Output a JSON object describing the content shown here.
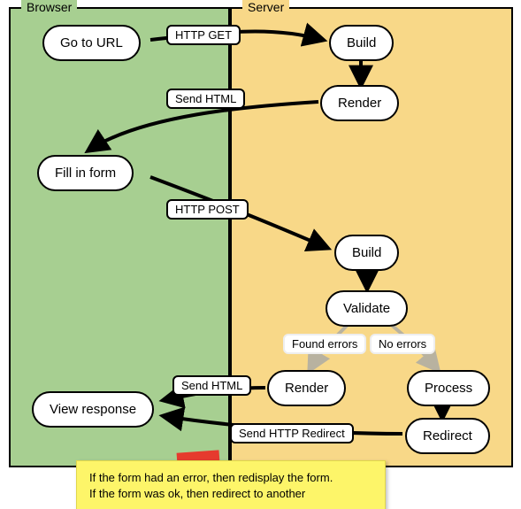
{
  "lanes": {
    "browser": "Browser",
    "server": "Server"
  },
  "steps": {
    "go_to_url": "Go to URL",
    "build1": "Build",
    "render1": "Render",
    "fill_form": "Fill in form",
    "build2": "Build",
    "validate": "Validate",
    "render2": "Render",
    "process": "Process",
    "view_resp": "View response",
    "redirect": "Redirect"
  },
  "edges": {
    "http_get": "HTTP GET",
    "send_html1": "Send HTML",
    "http_post": "HTTP POST",
    "found_errors": "Found errors",
    "no_errors": "No errors",
    "send_html2": "Send HTML",
    "send_redirect": "Send HTTP Redirect"
  },
  "note": {
    "line1": "If the form had an error, then redisplay the form.",
    "line2": "If the form was ok, then redirect to another"
  },
  "chart_data": {
    "type": "flow",
    "swimlanes": [
      "Browser",
      "Server"
    ],
    "nodes": [
      {
        "id": "go_to_url",
        "lane": "Browser",
        "label": "Go to URL"
      },
      {
        "id": "build1",
        "lane": "Server",
        "label": "Build"
      },
      {
        "id": "render1",
        "lane": "Server",
        "label": "Render"
      },
      {
        "id": "fill_form",
        "lane": "Browser",
        "label": "Fill in form"
      },
      {
        "id": "build2",
        "lane": "Server",
        "label": "Build"
      },
      {
        "id": "validate",
        "lane": "Server",
        "label": "Validate"
      },
      {
        "id": "render2",
        "lane": "Server",
        "label": "Render"
      },
      {
        "id": "process",
        "lane": "Server",
        "label": "Process"
      },
      {
        "id": "redirect",
        "lane": "Server",
        "label": "Redirect"
      },
      {
        "id": "view_resp",
        "lane": "Browser",
        "label": "View response"
      }
    ],
    "edges": [
      {
        "from": "go_to_url",
        "to": "build1",
        "label": "HTTP GET"
      },
      {
        "from": "build1",
        "to": "render1",
        "label": ""
      },
      {
        "from": "render1",
        "to": "fill_form",
        "label": "Send HTML"
      },
      {
        "from": "fill_form",
        "to": "build2",
        "label": "HTTP POST"
      },
      {
        "from": "build2",
        "to": "validate",
        "label": ""
      },
      {
        "from": "validate",
        "to": "render2",
        "label": "Found errors"
      },
      {
        "from": "validate",
        "to": "process",
        "label": "No errors"
      },
      {
        "from": "render2",
        "to": "view_resp",
        "label": "Send HTML"
      },
      {
        "from": "process",
        "to": "redirect",
        "label": ""
      },
      {
        "from": "redirect",
        "to": "view_resp",
        "label": "Send HTTP Redirect"
      }
    ],
    "annotation": "If the form had an error, then redisplay the form. If the form was ok, then redirect to another"
  }
}
